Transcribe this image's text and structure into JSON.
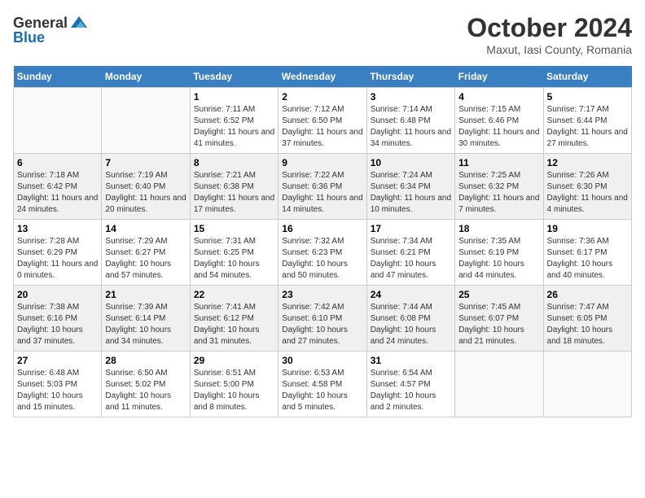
{
  "header": {
    "logo_general": "General",
    "logo_blue": "Blue",
    "month_title": "October 2024",
    "location": "Maxut, Iasi County, Romania"
  },
  "calendar": {
    "days_of_week": [
      "Sunday",
      "Monday",
      "Tuesday",
      "Wednesday",
      "Thursday",
      "Friday",
      "Saturday"
    ],
    "weeks": [
      [
        {
          "day": "",
          "sunrise": "",
          "sunset": "",
          "daylight": ""
        },
        {
          "day": "",
          "sunrise": "",
          "sunset": "",
          "daylight": ""
        },
        {
          "day": "1",
          "sunrise": "Sunrise: 7:11 AM",
          "sunset": "Sunset: 6:52 PM",
          "daylight": "Daylight: 11 hours and 41 minutes."
        },
        {
          "day": "2",
          "sunrise": "Sunrise: 7:12 AM",
          "sunset": "Sunset: 6:50 PM",
          "daylight": "Daylight: 11 hours and 37 minutes."
        },
        {
          "day": "3",
          "sunrise": "Sunrise: 7:14 AM",
          "sunset": "Sunset: 6:48 PM",
          "daylight": "Daylight: 11 hours and 34 minutes."
        },
        {
          "day": "4",
          "sunrise": "Sunrise: 7:15 AM",
          "sunset": "Sunset: 6:46 PM",
          "daylight": "Daylight: 11 hours and 30 minutes."
        },
        {
          "day": "5",
          "sunrise": "Sunrise: 7:17 AM",
          "sunset": "Sunset: 6:44 PM",
          "daylight": "Daylight: 11 hours and 27 minutes."
        }
      ],
      [
        {
          "day": "6",
          "sunrise": "Sunrise: 7:18 AM",
          "sunset": "Sunset: 6:42 PM",
          "daylight": "Daylight: 11 hours and 24 minutes."
        },
        {
          "day": "7",
          "sunrise": "Sunrise: 7:19 AM",
          "sunset": "Sunset: 6:40 PM",
          "daylight": "Daylight: 11 hours and 20 minutes."
        },
        {
          "day": "8",
          "sunrise": "Sunrise: 7:21 AM",
          "sunset": "Sunset: 6:38 PM",
          "daylight": "Daylight: 11 hours and 17 minutes."
        },
        {
          "day": "9",
          "sunrise": "Sunrise: 7:22 AM",
          "sunset": "Sunset: 6:36 PM",
          "daylight": "Daylight: 11 hours and 14 minutes."
        },
        {
          "day": "10",
          "sunrise": "Sunrise: 7:24 AM",
          "sunset": "Sunset: 6:34 PM",
          "daylight": "Daylight: 11 hours and 10 minutes."
        },
        {
          "day": "11",
          "sunrise": "Sunrise: 7:25 AM",
          "sunset": "Sunset: 6:32 PM",
          "daylight": "Daylight: 11 hours and 7 minutes."
        },
        {
          "day": "12",
          "sunrise": "Sunrise: 7:26 AM",
          "sunset": "Sunset: 6:30 PM",
          "daylight": "Daylight: 11 hours and 4 minutes."
        }
      ],
      [
        {
          "day": "13",
          "sunrise": "Sunrise: 7:28 AM",
          "sunset": "Sunset: 6:29 PM",
          "daylight": "Daylight: 11 hours and 0 minutes."
        },
        {
          "day": "14",
          "sunrise": "Sunrise: 7:29 AM",
          "sunset": "Sunset: 6:27 PM",
          "daylight": "Daylight: 10 hours and 57 minutes."
        },
        {
          "day": "15",
          "sunrise": "Sunrise: 7:31 AM",
          "sunset": "Sunset: 6:25 PM",
          "daylight": "Daylight: 10 hours and 54 minutes."
        },
        {
          "day": "16",
          "sunrise": "Sunrise: 7:32 AM",
          "sunset": "Sunset: 6:23 PM",
          "daylight": "Daylight: 10 hours and 50 minutes."
        },
        {
          "day": "17",
          "sunrise": "Sunrise: 7:34 AM",
          "sunset": "Sunset: 6:21 PM",
          "daylight": "Daylight: 10 hours and 47 minutes."
        },
        {
          "day": "18",
          "sunrise": "Sunrise: 7:35 AM",
          "sunset": "Sunset: 6:19 PM",
          "daylight": "Daylight: 10 hours and 44 minutes."
        },
        {
          "day": "19",
          "sunrise": "Sunrise: 7:36 AM",
          "sunset": "Sunset: 6:17 PM",
          "daylight": "Daylight: 10 hours and 40 minutes."
        }
      ],
      [
        {
          "day": "20",
          "sunrise": "Sunrise: 7:38 AM",
          "sunset": "Sunset: 6:16 PM",
          "daylight": "Daylight: 10 hours and 37 minutes."
        },
        {
          "day": "21",
          "sunrise": "Sunrise: 7:39 AM",
          "sunset": "Sunset: 6:14 PM",
          "daylight": "Daylight: 10 hours and 34 minutes."
        },
        {
          "day": "22",
          "sunrise": "Sunrise: 7:41 AM",
          "sunset": "Sunset: 6:12 PM",
          "daylight": "Daylight: 10 hours and 31 minutes."
        },
        {
          "day": "23",
          "sunrise": "Sunrise: 7:42 AM",
          "sunset": "Sunset: 6:10 PM",
          "daylight": "Daylight: 10 hours and 27 minutes."
        },
        {
          "day": "24",
          "sunrise": "Sunrise: 7:44 AM",
          "sunset": "Sunset: 6:08 PM",
          "daylight": "Daylight: 10 hours and 24 minutes."
        },
        {
          "day": "25",
          "sunrise": "Sunrise: 7:45 AM",
          "sunset": "Sunset: 6:07 PM",
          "daylight": "Daylight: 10 hours and 21 minutes."
        },
        {
          "day": "26",
          "sunrise": "Sunrise: 7:47 AM",
          "sunset": "Sunset: 6:05 PM",
          "daylight": "Daylight: 10 hours and 18 minutes."
        }
      ],
      [
        {
          "day": "27",
          "sunrise": "Sunrise: 6:48 AM",
          "sunset": "Sunset: 5:03 PM",
          "daylight": "Daylight: 10 hours and 15 minutes."
        },
        {
          "day": "28",
          "sunrise": "Sunrise: 6:50 AM",
          "sunset": "Sunset: 5:02 PM",
          "daylight": "Daylight: 10 hours and 11 minutes."
        },
        {
          "day": "29",
          "sunrise": "Sunrise: 6:51 AM",
          "sunset": "Sunset: 5:00 PM",
          "daylight": "Daylight: 10 hours and 8 minutes."
        },
        {
          "day": "30",
          "sunrise": "Sunrise: 6:53 AM",
          "sunset": "Sunset: 4:58 PM",
          "daylight": "Daylight: 10 hours and 5 minutes."
        },
        {
          "day": "31",
          "sunrise": "Sunrise: 6:54 AM",
          "sunset": "Sunset: 4:57 PM",
          "daylight": "Daylight: 10 hours and 2 minutes."
        },
        {
          "day": "",
          "sunrise": "",
          "sunset": "",
          "daylight": ""
        },
        {
          "day": "",
          "sunrise": "",
          "sunset": "",
          "daylight": ""
        }
      ]
    ]
  }
}
